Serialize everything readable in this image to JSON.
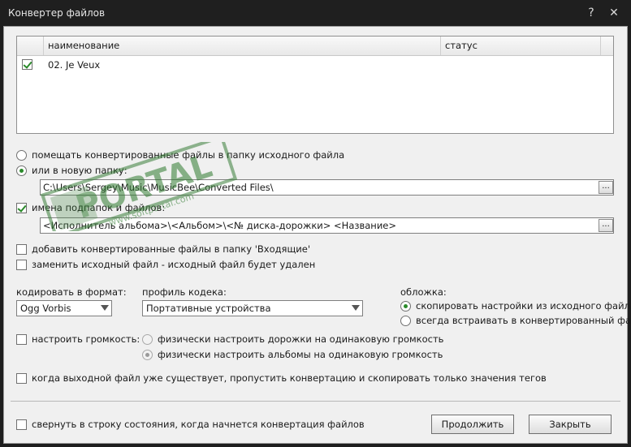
{
  "window": {
    "title": "Конвертер файлов",
    "help_label": "?",
    "close_label": "✕"
  },
  "file_list": {
    "columns": [
      "наименование",
      "статус"
    ],
    "rows": [
      {
        "name": "02. Je Veux",
        "status": "",
        "checked": true
      }
    ]
  },
  "destination": {
    "source_folder_label": "помещать конвертированные файлы в папку исходного файла",
    "new_folder_label": "или в новую папку:",
    "new_folder_path": "C:\\Users\\Sergey\\Music\\MusicBee\\Converted Files\\",
    "subfolders_label": "имена подпапок и файлов:",
    "subfolders_pattern": "<Исполнитель альбома>\\<Альбом>\\<№ диска-дорожки> <Название>",
    "browse_label": "..."
  },
  "options": {
    "add_to_inbox_label": "добавить конвертированные файлы в папку 'Входящие'",
    "replace_source_label": "заменить исходный файл  - исходный файл будет удален"
  },
  "encode": {
    "format_label": "кодировать в формат:",
    "format_value": "Ogg Vorbis",
    "profile_label": "профиль кодека:",
    "profile_value": "Портативные устройства"
  },
  "cover": {
    "label": "обложка:",
    "copy_label": "скопировать настройки из исходного файла",
    "embed_label": "всегда встраивать в конвертированный файл"
  },
  "volume": {
    "label": "настроить громкость:",
    "tracks_label": "физически настроить дорожки на одинаковую громкость",
    "albums_label": "физически настроить альбомы на одинаковую громкость"
  },
  "skip_existing_label": "когда выходной файл уже существует, пропустить конвертацию и скопировать только значения тегов",
  "minimize_label": "свернуть в строку состояния, когда начнется конвертация файлов",
  "buttons": {
    "continue": "Продолжить",
    "close": "Закрыть"
  },
  "watermark": {
    "brand": "PORTAL",
    "url": "www.softportal.com",
    "tm": "TM"
  }
}
